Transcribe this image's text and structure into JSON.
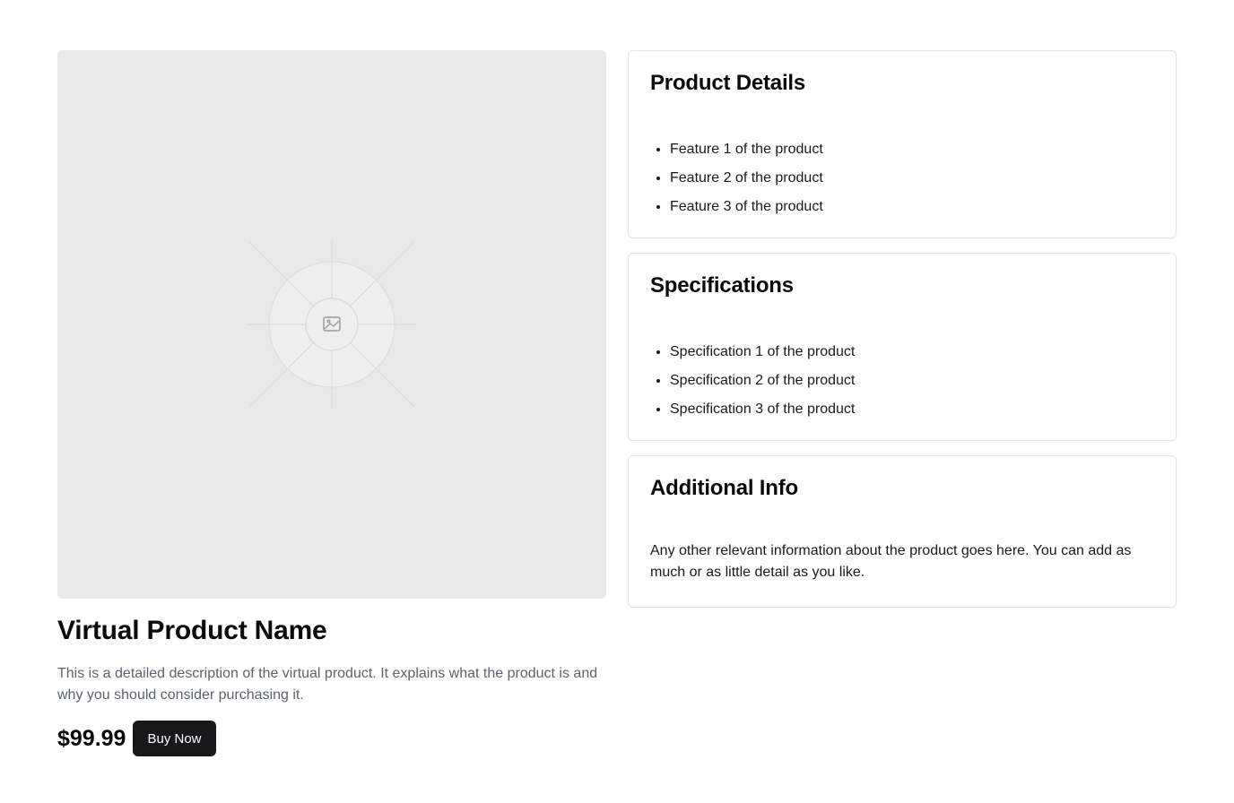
{
  "product": {
    "name": "Virtual Product Name",
    "description": "This is a detailed description of the virtual product. It explains what the product is and why you should consider purchasing it.",
    "price": "$99.99",
    "buy_label": "Buy Now",
    "image_icon": "image-icon"
  },
  "details": {
    "title": "Product Details",
    "items": [
      "Feature 1 of the product",
      "Feature 2 of the product",
      "Feature 3 of the product"
    ]
  },
  "specifications": {
    "title": "Specifications",
    "items": [
      "Specification 1 of the product",
      "Specification 2 of the product",
      "Specification 3 of the product"
    ]
  },
  "additional": {
    "title": "Additional Info",
    "text": "Any other relevant information about the product goes here. You can add as much or as little detail as you like."
  },
  "colors": {
    "button_bg": "#18181b",
    "placeholder_bg": "#e8e8e8",
    "description_text": "#5b6270"
  }
}
